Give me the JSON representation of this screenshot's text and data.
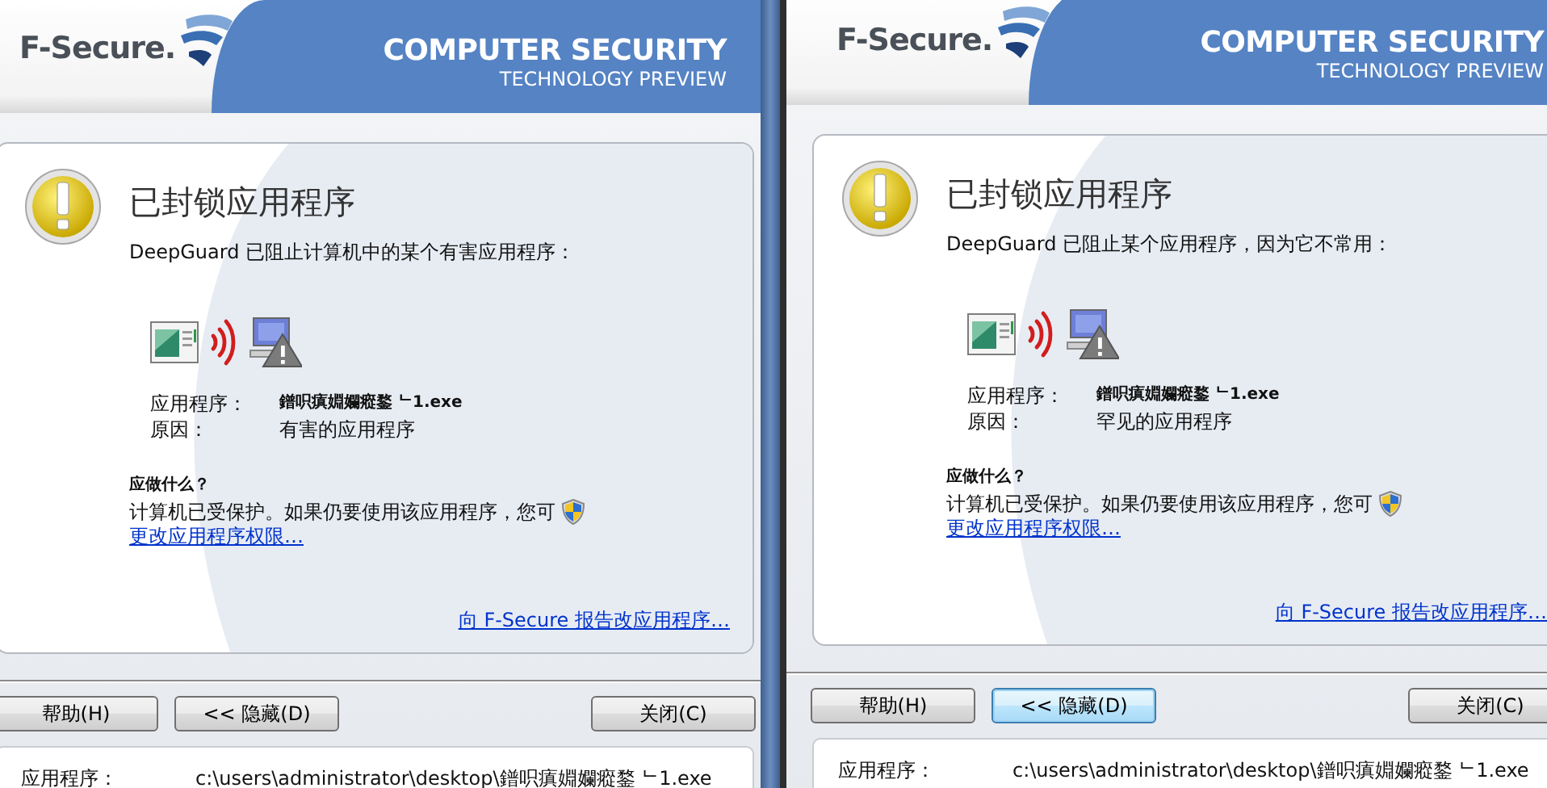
{
  "dialogs": [
    {
      "header": {
        "logo": "F-Secure.",
        "product": "COMPUTER SECURITY",
        "edition": "TECHNOLOGY PREVIEW"
      },
      "title": "已封锁应用程序",
      "message": "DeepGuard 已阻止计算机中的某个有害应用程序：",
      "application_label": "应用程序：",
      "application_value": "鐠呮瘨婣孄瘲鍪 ᄂ1.exe",
      "reason_label": "原因：",
      "reason_value": "有害的应用程序",
      "advice_heading": "应做什么？",
      "advice": "计算机已受保护。如果仍要使用该应用程序，您可",
      "change_link": "更改应用程序权限…",
      "report_link": "向 F-Secure 报告改应用程序…",
      "buttons": [
        {
          "label": "帮助(H)",
          "focused": false
        },
        {
          "label": "<< 隐藏(D)",
          "focused": false
        },
        {
          "label": "关闭(C)",
          "focused": false
        }
      ],
      "details": {
        "label": "应用程序：",
        "path": "c:\\users\\administrator\\desktop\\鐠呮瘨婣孄瘲鍪 ᄂ1.exe"
      }
    },
    {
      "header": {
        "logo": "F-Secure.",
        "product": "COMPUTER SECURITY",
        "edition": "TECHNOLOGY PREVIEW"
      },
      "title": "已封锁应用程序",
      "message": "DeepGuard 已阻止某个应用程序，因为它不常用：",
      "application_label": "应用程序：",
      "application_value": "鐠呮瘨婣孄瘲鍪 ᄂ1.exe",
      "reason_label": "原因：",
      "reason_value": "罕见的应用程序",
      "advice_heading": "应做什么？",
      "advice": "计算机已受保护。如果仍要使用该应用程序，您可",
      "change_link": "更改应用程序权限…",
      "report_link": "向 F-Secure 报告改应用程序…",
      "buttons": [
        {
          "label": "帮助(H)",
          "focused": false
        },
        {
          "label": "<< 隐藏(D)",
          "focused": true
        },
        {
          "label": "关闭(C)",
          "focused": false
        }
      ],
      "details": {
        "label": "应用程序：",
        "path": "c:\\users\\administrator\\desktop\\鐠呮瘨婣孄瘲鍪 ᄂ1.exe"
      }
    }
  ]
}
